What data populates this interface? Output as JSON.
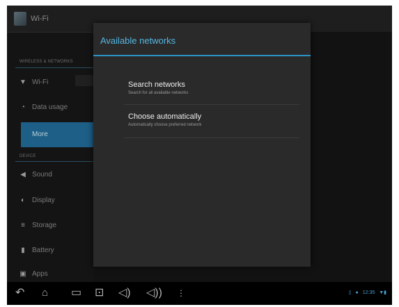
{
  "header": {
    "title": "Wi-Fi"
  },
  "settings": {
    "sections": [
      {
        "label": "WIRELESS & NETWORKS"
      },
      {
        "label": "DEVICE"
      }
    ],
    "items": [
      {
        "label": "Wi-Fi",
        "icon": "wifi-icon"
      },
      {
        "label": "Data usage",
        "icon": "data-usage-icon"
      },
      {
        "label": "More",
        "icon": "",
        "selected": true
      },
      {
        "label": "Sound",
        "icon": "sound-icon"
      },
      {
        "label": "Display",
        "icon": "display-icon"
      },
      {
        "label": "Storage",
        "icon": "storage-icon"
      },
      {
        "label": "Battery",
        "icon": "battery-icon"
      },
      {
        "label": "Apps",
        "icon": "apps-icon"
      }
    ]
  },
  "dialog": {
    "title": "Available networks",
    "options": [
      {
        "title": "Search networks",
        "subtitle": "Search for all available networks"
      },
      {
        "title": "Choose automatically",
        "subtitle": "Automatically choose preferred network"
      }
    ]
  },
  "statusbar": {
    "time": "12:35"
  },
  "colors": {
    "accent": "#2d93c8",
    "title": "#56b7e2",
    "selected": "#1d5f86"
  }
}
